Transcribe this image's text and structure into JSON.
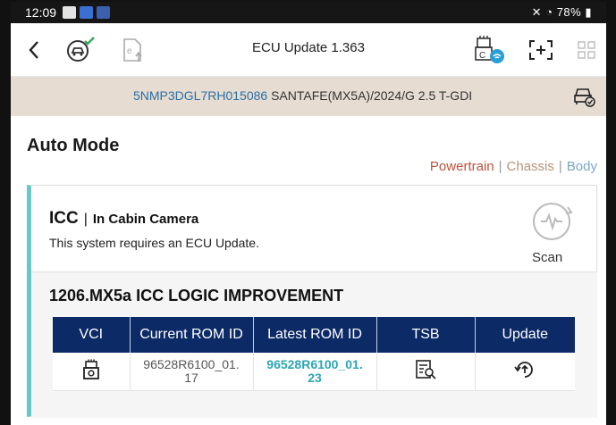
{
  "status": {
    "time": "12:09",
    "battery": "78%",
    "signal": "✕ ◔ 78%"
  },
  "toolbar": {
    "title": "ECU Update 1.363"
  },
  "vehicle": {
    "vin": "5NMP3DGL7RH015086",
    "model": "SANTAFE(MX5A)/2024/G 2.5 T-GDI"
  },
  "main": {
    "mode_title": "Auto Mode",
    "filters": {
      "powertrain": "Powertrain",
      "chassis": "Chassis",
      "body": "Body",
      "separator": "|"
    }
  },
  "system": {
    "code": "ICC",
    "separator": "|",
    "name": "In Cabin Camera",
    "description": "This system requires an ECU Update.",
    "scan_label": "Scan"
  },
  "update": {
    "title": "1206.MX5a ICC LOGIC IMPROVEMENT",
    "columns": [
      "VCI",
      "Current ROM ID",
      "Latest ROM ID",
      "TSB",
      "Update"
    ],
    "row": {
      "current_rom_line1": "96528R6100_01.",
      "current_rom_line2": "17",
      "latest_rom_line1": "96528R6100_01.",
      "latest_rom_line2": "23"
    }
  },
  "colors": {
    "accent": "#6ac6c8",
    "table_header": "#0c2a66",
    "powertrain": "#c0503a",
    "chassis": "#b8957a",
    "body": "#7aa6cf"
  }
}
